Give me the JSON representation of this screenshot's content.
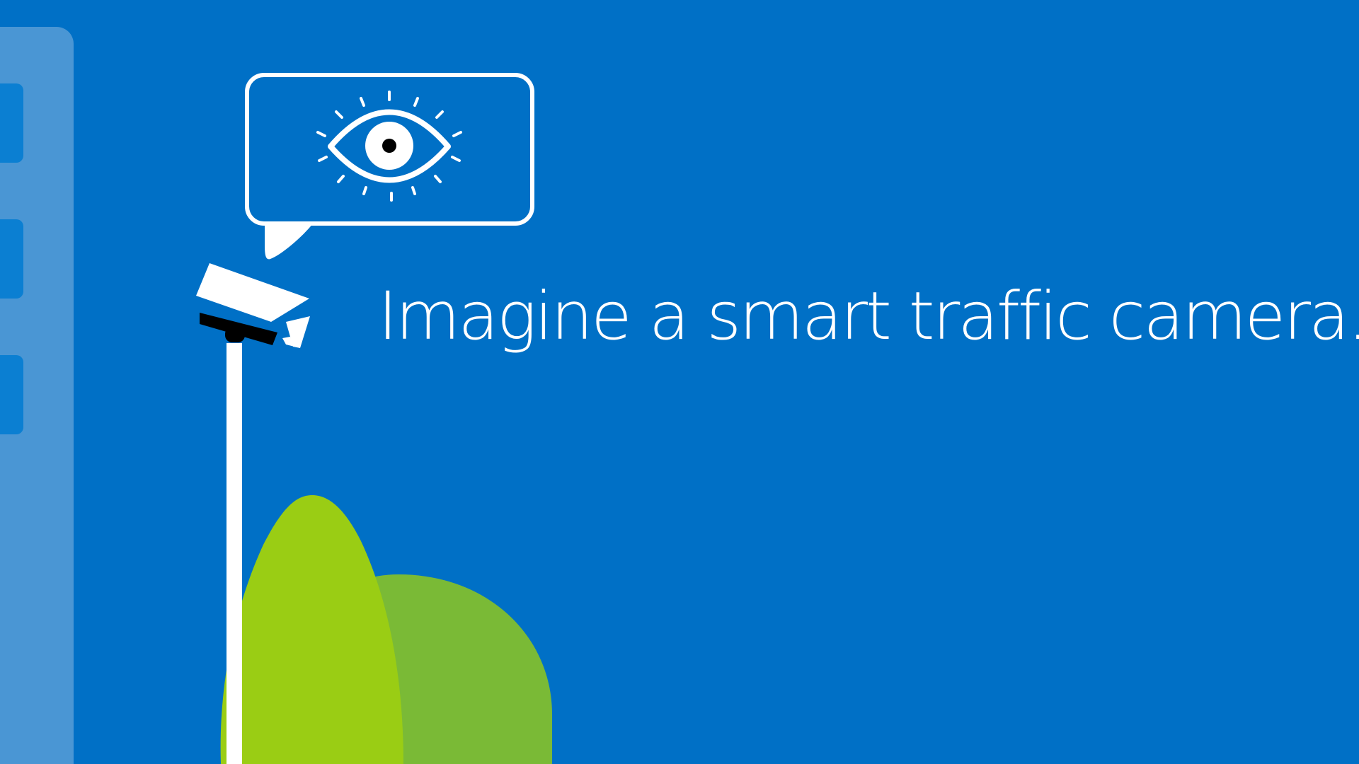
{
  "headline": "Imagine a smart traffic camera.",
  "icons": {
    "speech_bubble": "speech-bubble-icon",
    "eye": "eye-icon",
    "camera": "security-camera-icon"
  },
  "colors": {
    "background": "#0070c6",
    "side_panel": "#4a96d4",
    "panel_tab": "#0b7fd2",
    "outline": "#ffffff",
    "pupil": "#000000",
    "camera_dark": "#000000",
    "tree_light": "#9acd14",
    "tree_dark": "#7aba36"
  }
}
